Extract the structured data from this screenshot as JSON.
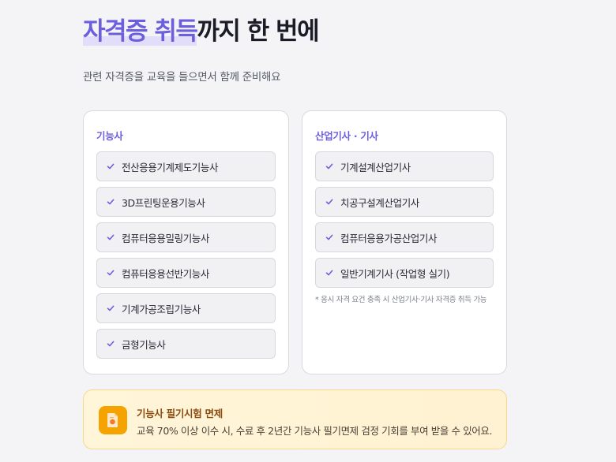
{
  "header": {
    "headline_highlight": "자격증 취득",
    "headline_rest": "까지 한 번에",
    "subtitle": "관련 자격증을 교육을 들으면서 함께 준비해요"
  },
  "cards": [
    {
      "title": "기능사",
      "items": [
        "전산응용기계제도기능사",
        "3D프린팅운용기능사",
        "컴퓨터응용밀링기능사",
        "컴퓨터응용선반기능사",
        "기계가공조립기능사",
        "금형기능사"
      ]
    },
    {
      "title": "산업기사 · 기사",
      "items": [
        "기계설계산업기사",
        "치공구설계산업기사",
        "컴퓨터응용가공산업기사",
        "일반기계기사 (작업형 실기)"
      ],
      "note": "* 응시 자격 요건 충족 시 산업기사·기사 자격증 취득 가능"
    }
  ],
  "banner": {
    "title": "기능사 필기시험 면제",
    "text": "교육 70% 이상 이수 시, 수료 후 2년간 기능사 필기면제 검정 기회를 부여 받을 수 있어요.",
    "icon": "document-icon"
  },
  "colors": {
    "accent": "#6b5fe0",
    "highlight": "#e2defa",
    "banner_bg": "#fff5d8",
    "banner_border": "#f7d98a",
    "banner_icon_bg": "#f5a300",
    "banner_title": "#8a4b10"
  }
}
